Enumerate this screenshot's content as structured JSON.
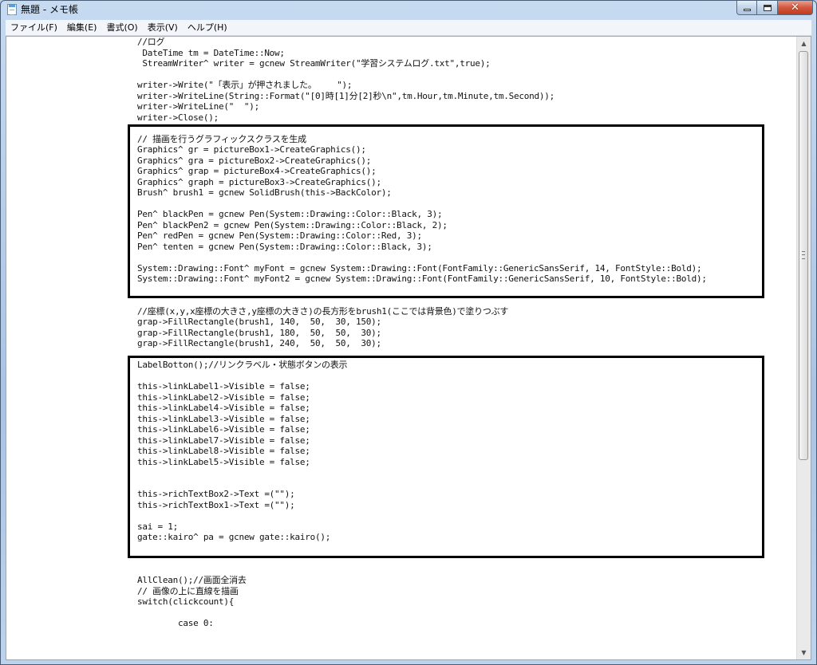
{
  "window": {
    "title": "無題 - メモ帳",
    "icons": {
      "app": "notepad-icon",
      "minimize": "minimize-icon",
      "maximize": "maximize-icon",
      "close": "close-icon",
      "scroll_up": "scroll-up-arrow-icon",
      "scroll_down": "scroll-down-arrow-icon"
    }
  },
  "menu": {
    "items": [
      "ファイル(F)",
      "編集(E)",
      "書式(O)",
      "表示(V)",
      "ヘルプ(H)"
    ]
  },
  "editor": {
    "lines": [
      "//ログ",
      " DateTime tm = DateTime::Now;",
      " StreamWriter^ writer = gcnew StreamWriter(\"学習システムログ.txt\",true);",
      "",
      "writer->Write(\"「表示」が押されました。    \");",
      "writer->WriteLine(String::Format(\"[0]時[1]分[2]秒\\n\",tm.Hour,tm.Minute,tm.Second));",
      "writer->WriteLine(\"  \");",
      "writer->Close();",
      "",
      "// 描画を行うグラフィックスクラスを生成",
      "Graphics^ gr = pictureBox1->CreateGraphics();",
      "Graphics^ gra = pictureBox2->CreateGraphics();",
      "Graphics^ grap = pictureBox4->CreateGraphics();",
      "Graphics^ graph = pictureBox3->CreateGraphics();",
      "Brush^ brush1 = gcnew SolidBrush(this->BackColor);",
      "",
      "Pen^ blackPen = gcnew Pen(System::Drawing::Color::Black, 3);",
      "Pen^ blackPen2 = gcnew Pen(System::Drawing::Color::Black, 2);",
      "Pen^ redPen = gcnew Pen(System::Drawing::Color::Red, 3);",
      "Pen^ tenten = gcnew Pen(System::Drawing::Color::Black, 3);",
      "",
      "System::Drawing::Font^ myFont = gcnew System::Drawing::Font(FontFamily::GenericSansSerif, 14, FontStyle::Bold);",
      "System::Drawing::Font^ myFont2 = gcnew System::Drawing::Font(FontFamily::GenericSansSerif, 10, FontStyle::Bold);",
      "",
      "",
      "//座標(x,y,x座標の大きさ,y座標の大きさ)の長方形をbrush1(ここでは背景色)で塗りつぶす",
      "grap->FillRectangle(brush1, 140,  50,  30, 150);",
      "grap->FillRectangle(brush1, 180,  50,  50,  30);",
      "grap->FillRectangle(brush1, 240,  50,  50,  30);",
      "",
      "LabelBotton();//リンクラベル・状態ボタンの表示",
      "",
      "this->linkLabel1->Visible = false;",
      "this->linkLabel2->Visible = false;",
      "this->linkLabel4->Visible = false;",
      "this->linkLabel3->Visible = false;",
      "this->linkLabel6->Visible = false;",
      "this->linkLabel7->Visible = false;",
      "this->linkLabel8->Visible = false;",
      "this->linkLabel5->Visible = false;",
      "",
      "",
      "this->richTextBox2->Text =(\"\");",
      "this->richTextBox1->Text =(\"\");",
      "",
      "sai = 1;",
      "gate::kairo^ pa = gcnew gate::kairo();",
      "",
      "",
      "",
      "AllClean();//画面全消去",
      "// 画像の上に直線を描画",
      "switch(clickcount){",
      "",
      "        case 0:"
    ]
  }
}
